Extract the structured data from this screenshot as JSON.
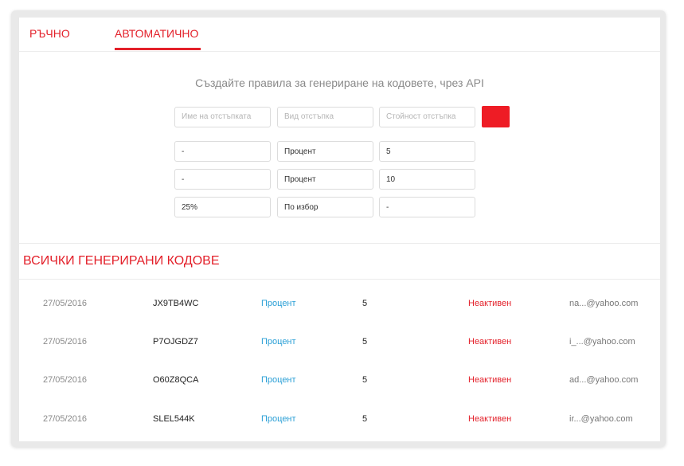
{
  "tabs": {
    "manual": "РЪЧНО",
    "automatic": "АВТОМАТИЧНО",
    "active": "automatic"
  },
  "rules": {
    "title": "Създайте правила за генериране на кодовете, чрез API",
    "new_rule": {
      "name_placeholder": "Име на отстъпката",
      "type_placeholder": "Вид отстъпка",
      "value_placeholder": "Стойност отстъпка"
    },
    "items": [
      {
        "name": "-",
        "type": "Процент",
        "value": "5"
      },
      {
        "name": "-",
        "type": "Процент",
        "value": "10"
      },
      {
        "name": "25%",
        "type": "По избор",
        "value": "-"
      }
    ]
  },
  "codes": {
    "title": "ВСИЧКИ ГЕНЕРИРАНИ КОДОВЕ",
    "rows": [
      {
        "date": "27/05/2016",
        "code": "JX9TB4WC",
        "type": "Процент",
        "value": "5",
        "status": "Неактивен",
        "email": "na...@yahoo.com"
      },
      {
        "date": "27/05/2016",
        "code": "P7OJGDZ7",
        "type": "Процент",
        "value": "5",
        "status": "Неактивен",
        "email": "i_...@yahoo.com"
      },
      {
        "date": "27/05/2016",
        "code": "O60Z8QCA",
        "type": "Процент",
        "value": "5",
        "status": "Неактивен",
        "email": "ad...@yahoo.com"
      },
      {
        "date": "27/05/2016",
        "code": "SLEL544K",
        "type": "Процент",
        "value": "5",
        "status": "Неактивен",
        "email": "ir...@yahoo.com"
      }
    ]
  },
  "colors": {
    "accent": "#e3202a",
    "button": "#ee1c25",
    "link": "#2a9fd6"
  }
}
